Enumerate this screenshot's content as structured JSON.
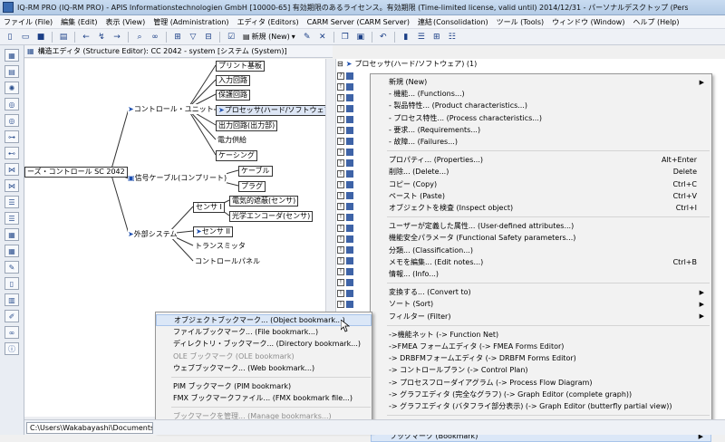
{
  "window": {
    "title": "IQ-RM PRO (IQ-RM PRO) - APIS Informationstechnologien GmbH [10000-65] 有効期限のあるライセンス。有効期限 (Time-limited license, valid until) 2014/12/31 - パーソナルデスクトップ (Personal Deskt..."
  },
  "menubar": [
    "ファイル (File)",
    "編集 (Edit)",
    "表示 (View)",
    "管理 (Administration)",
    "エディタ (Editors)",
    "CARM Server (CARM Server)",
    "連結",
    "(Consolidation)",
    "ツール (Tools)",
    "ウィンドウ (Window)",
    "ヘルプ (Help)"
  ],
  "toolbar": {
    "new_label": "新規 (New)"
  },
  "editor": {
    "header": "構造エディタ (Structure Editor): CC 2042 - system [システム (System)]",
    "nodes": {
      "root": "ーズ・コントロール SC 2042",
      "control_unit": "コントロール・ユニット",
      "signal_cable": "信号ケーブル(コンプリート)",
      "external_system": "外部システム",
      "pcb": "プリント基板",
      "input_circuit": "入力回路",
      "protection_circuit": "保護回路",
      "processor": "プロセッサ(ハード/ソフトウェア)",
      "output_circuit": "出力回路(出力部)",
      "power_supply": "電力供給",
      "casing": "ケーシング",
      "cable": "ケーブル",
      "plug": "プラグ",
      "sensor1": "センサ I",
      "sensor2": "センサ II",
      "transmitter": "トランスミッタ",
      "control_panel": "コントロールパネル",
      "electric_breaker": "電気的遮蔽(センサ)",
      "optical_encoder": "光学エンコーダ(センサ)"
    }
  },
  "right_pane": {
    "header": "プロセッサ(ハード/ソフトウェア) (1)",
    "tree_marks": [
      "?",
      "!",
      "!",
      "!",
      "!",
      "!",
      "!",
      "!",
      "!",
      "!",
      "!",
      "!",
      "!",
      "!",
      "!",
      "!",
      "!",
      "!",
      "!",
      "!",
      "!",
      "!",
      "!",
      "!",
      "!",
      "!",
      "!",
      "!",
      "!",
      "!"
    ]
  },
  "context_menu": [
    {
      "label": "新規 (New)",
      "submenu": true
    },
    {
      "label": "- 機能... (Functions...)"
    },
    {
      "label": "- 製品特性... (Product characteristics...)"
    },
    {
      "label": "- プロセス特性... (Process characteristics...)"
    },
    {
      "label": "- 要求... (Requirements...)"
    },
    {
      "label": "- 故障... (Failures...)"
    },
    {
      "sep": true
    },
    {
      "label": "プロパティ... (Properties...)",
      "shortcut": "Alt+Enter"
    },
    {
      "label": "削除... (Delete...)",
      "shortcut": "Delete"
    },
    {
      "label": "コピー (Copy)",
      "shortcut": "Ctrl+C"
    },
    {
      "label": "ペースト (Paste)",
      "shortcut": "Ctrl+V"
    },
    {
      "label": "オブジェクトを検査 (Inspect object)",
      "shortcut": "Ctrl+I"
    },
    {
      "sep": true
    },
    {
      "label": "ユーザーが定義した属性... (User-defined attributes...)"
    },
    {
      "label": "機能安全パラメータ (Functional Safety parameters...)"
    },
    {
      "label": "分類... (Classification...)"
    },
    {
      "label": "メモを編集... (Edit notes...)",
      "shortcut": "Ctrl+B"
    },
    {
      "label": "情報... (Info...)"
    },
    {
      "sep": true
    },
    {
      "label": "変換する... (Convert to)",
      "submenu": true
    },
    {
      "label": "ソート (Sort)",
      "submenu": true
    },
    {
      "label": "フィルター (Filter)",
      "submenu": true
    },
    {
      "sep": true
    },
    {
      "label": "->機能ネット (-> Function Net)"
    },
    {
      "label": "->FMEA フォームエディタ (-> FMEA Forms Editor)"
    },
    {
      "label": "-> DRBFMフォームエディタ (-> DRBFM Forms Editor)"
    },
    {
      "label": "-> コントロールプラン (-> Control Plan)"
    },
    {
      "label": "-> プロセスフローダイアグラム (-> Process Flow Diagram)"
    },
    {
      "label": "-> グラフエディタ (完全なグラフ) (-> Graph Editor (complete graph))"
    },
    {
      "label": "-> グラフエディタ (バタフライ部分表示) (-> Graph Editor (butterfly partial view))"
    },
    {
      "sep": true
    },
    {
      "label": "表示オプション... (Display options...)"
    },
    {
      "label": "ブックマーク (Bookmark)",
      "submenu": true,
      "highlighted": true
    }
  ],
  "bookmark_submenu": [
    {
      "label": "オブジェクトブックマーク... (Object bookmark...)",
      "highlighted": true
    },
    {
      "label": "ファイルブックマーク... (File bookmark...)"
    },
    {
      "label": "ディレクトリ・ブックマーク... (Directory bookmark...)"
    },
    {
      "label": "OLE ブックマーク (OLE bookmark)",
      "disabled": true
    },
    {
      "label": "ウェブブックマーク... (Web bookmark...)"
    },
    {
      "sep": true
    },
    {
      "label": "PIM ブックマーク (PIM bookmark)"
    },
    {
      "label": "FMX ブックマークファイル... (FMX bookmark file...)"
    },
    {
      "sep": true
    },
    {
      "label": "ブックマークを管理... (Manage bookmarks...)",
      "disabled": true
    },
    {
      "label": "FMX ブックマークリスト... (FMX bookmark list...)"
    }
  ],
  "statusbar": {
    "path": "C:\\Users\\Wakabayashi\\Documents\\IQ-D"
  }
}
